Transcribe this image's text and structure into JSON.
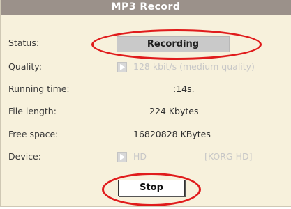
{
  "dialog": {
    "title": "MP3 Record",
    "status": {
      "label": "Status:",
      "value": "Recording"
    },
    "quality": {
      "label": "Quality:",
      "value": "128 kbit/s (medium quality)"
    },
    "running_time": {
      "label": "Running time:",
      "value": ":14s."
    },
    "file_length": {
      "label": "File length:",
      "value": "224 Kbytes"
    },
    "free_space": {
      "label": "Free space:",
      "value": "16820828 KBytes"
    },
    "device": {
      "label": "Device:",
      "value": "HD",
      "volume": "[KORG HD]"
    },
    "stop_button": "Stop"
  },
  "colors": {
    "titlebar": "#9b918a",
    "background": "#f7f1dc",
    "highlight_ellipse": "#e01c1c",
    "disabled_text": "#c7c7c7"
  },
  "icons": {
    "selector": "play-triangle-icon"
  }
}
